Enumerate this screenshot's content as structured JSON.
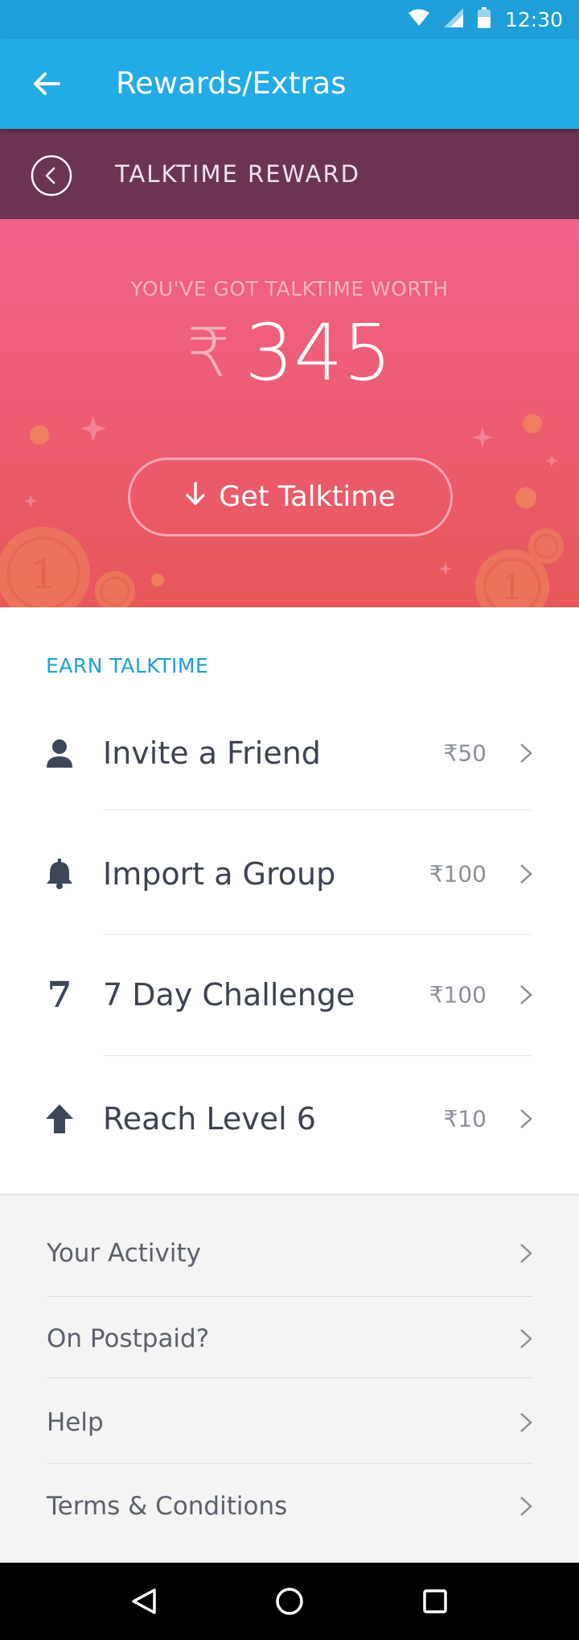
{
  "status_bar": {
    "time": "12:30",
    "icons": [
      "wifi-icon",
      "signal-icon",
      "battery-icon"
    ]
  },
  "app_bar": {
    "title": "Rewards/Extras",
    "back_icon": "arrow-left-icon"
  },
  "section": {
    "title": "TALKTIME REWARD",
    "back_icon": "chevron-left-circle-icon"
  },
  "hero": {
    "subtitle": "YOU'VE GOT TALKTIME WORTH",
    "currency": "₹",
    "amount": "345",
    "button_label": "Get Talktime",
    "button_icon": "arrow-down-icon"
  },
  "earn": {
    "heading": "EARN TALKTIME",
    "items": [
      {
        "label": "Invite a Friend",
        "currency": "₹",
        "amount": "50",
        "icon": "person-icon"
      },
      {
        "label": "Import a Group",
        "currency": "₹",
        "amount": "100",
        "icon": "bell-icon"
      },
      {
        "label": "7 Day Challenge",
        "currency": "₹",
        "amount": "100",
        "icon": "seven-icon",
        "icon_text": "7"
      },
      {
        "label": "Reach Level 6",
        "currency": "₹",
        "amount": "10",
        "icon": "arrow-up-icon"
      }
    ]
  },
  "more": {
    "items": [
      {
        "label": "Your Activity"
      },
      {
        "label": "On Postpaid?"
      },
      {
        "label": "Help"
      },
      {
        "label": "Terms & Conditions"
      }
    ]
  },
  "nav": {
    "buttons": [
      "back-triangle-icon",
      "home-circle-icon",
      "recents-square-icon"
    ]
  },
  "colors": {
    "status_bar": "#1e9fd9",
    "app_bar": "#22abe6",
    "section_bar": "#6a3452",
    "hero_top": "#f2628a",
    "hero_bottom": "#e7585a",
    "accent": "#1e9fd9"
  }
}
